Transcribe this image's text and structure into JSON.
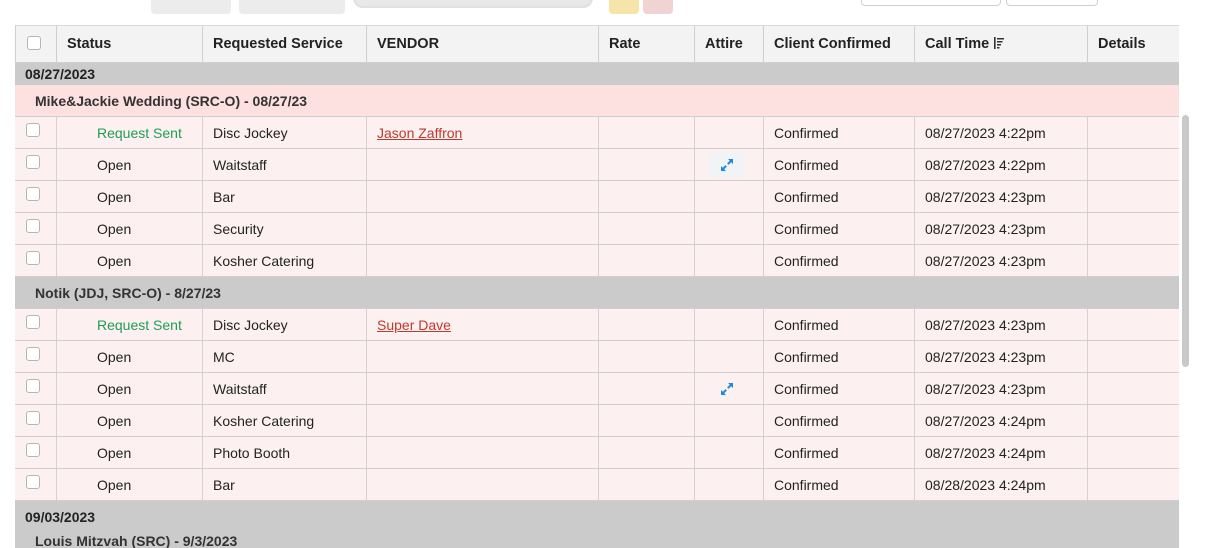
{
  "columns": {
    "status": "Status",
    "requested_service": "Requested Service",
    "vendor": "VENDOR",
    "rate": "Rate",
    "attire": "Attire",
    "client_confirmed": "Client Confirmed",
    "call_time": "Call Time",
    "details": "Details"
  },
  "groups": [
    {
      "date": "08/27/2023",
      "event": "Mike&Jackie Wedding (SRC-O) - 08/27/23",
      "rows": [
        {
          "status": "Request Sent",
          "service": "Disc Jockey",
          "vendor": "Jason Zaffron",
          "confirmed": "Confirmed",
          "call_time": "08/27/2023 4:22pm"
        },
        {
          "status": "Open",
          "service": "Waitstaff",
          "vendor": "",
          "confirmed": "Confirmed",
          "call_time": "08/27/2023 4:22pm"
        },
        {
          "status": "Open",
          "service": "Bar",
          "vendor": "",
          "confirmed": "Confirmed",
          "call_time": "08/27/2023 4:23pm"
        },
        {
          "status": "Open",
          "service": "Security",
          "vendor": "",
          "confirmed": "Confirmed",
          "call_time": "08/27/2023 4:23pm"
        },
        {
          "status": "Open",
          "service": "Kosher Catering",
          "vendor": "",
          "confirmed": "Confirmed",
          "call_time": "08/27/2023 4:23pm"
        }
      ]
    },
    {
      "event": "Notik (JDJ, SRC-O) - 8/27/23",
      "rows": [
        {
          "status": "Request Sent",
          "service": "Disc Jockey",
          "vendor": "Super Dave",
          "confirmed": "Confirmed",
          "call_time": "08/27/2023 4:23pm"
        },
        {
          "status": "Open",
          "service": "MC",
          "vendor": "",
          "confirmed": "Confirmed",
          "call_time": "08/27/2023 4:23pm"
        },
        {
          "status": "Open",
          "service": "Waitstaff",
          "vendor": "",
          "confirmed": "Confirmed",
          "call_time": "08/27/2023 4:23pm"
        },
        {
          "status": "Open",
          "service": "Kosher Catering",
          "vendor": "",
          "confirmed": "Confirmed",
          "call_time": "08/27/2023 4:24pm"
        },
        {
          "status": "Open",
          "service": "Photo Booth",
          "vendor": "",
          "confirmed": "Confirmed",
          "call_time": "08/27/2023 4:24pm"
        },
        {
          "status": "Open",
          "service": "Bar",
          "vendor": "",
          "confirmed": "Confirmed",
          "call_time": "08/28/2023 4:24pm"
        }
      ]
    },
    {
      "date": "09/03/2023",
      "event": "Louis Mitzvah (SRC) - 9/3/2023"
    }
  ],
  "colors": {
    "status_sent": "#1f9d55",
    "vendor_link": "#c0392b",
    "row_bg": "#fdf0f0",
    "group_pink": "#fde0e0",
    "group_gray": "#cbcbcb",
    "expand_icon": "#1e88e5"
  },
  "icons": {
    "sort": "sort-descending-icon",
    "expand": "expand-icon"
  }
}
